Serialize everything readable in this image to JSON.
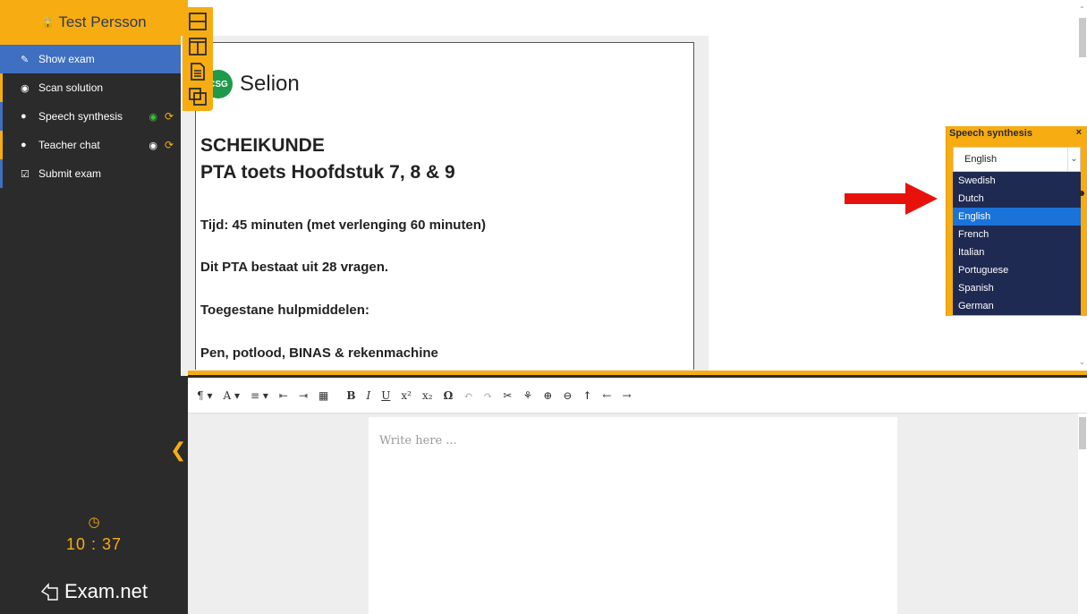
{
  "sidebar": {
    "user_name": "Test Persson",
    "items": [
      {
        "label": "Show exam",
        "icon": "pencil-square-icon",
        "active": true
      },
      {
        "label": "Scan solution",
        "icon": "camera-icon"
      },
      {
        "label": "Speech synthesis",
        "icon": "speech-bubble-icon",
        "status": "active-green"
      },
      {
        "label": "Teacher chat",
        "icon": "chat-bubbles-icon",
        "status": "target"
      },
      {
        "label": "Submit exam",
        "icon": "check-square-icon"
      }
    ],
    "timer": "10 : 37",
    "logo_text": "Exam.net"
  },
  "layout_switcher": {
    "icons": [
      "split-horizontal-icon",
      "split-vertical-icon",
      "document-icon",
      "copy-icon"
    ]
  },
  "exam": {
    "brand_badge": "CSG",
    "brand_name": "Selion",
    "subject": "SCHEIKUNDE",
    "title": "PTA toets Hoofdstuk 7, 8 & 9",
    "lines": [
      "Tijd: 45 minuten (met verlenging 60 minuten)",
      "Dit PTA bestaat uit 28 vragen.",
      "Toegestane hulpmiddelen:",
      "Pen, potlood, BINAS & rekenmachine"
    ]
  },
  "toolbar": {
    "buttons": [
      "¶ ▾",
      "A ▾",
      "≡ ▾",
      "⇤",
      "⇥",
      "▦",
      "B",
      "I",
      "U",
      "x²",
      "x₂",
      "Ω",
      "↶",
      "↷",
      "✂",
      "⚘",
      "⊕",
      "⊖",
      "↑",
      "←",
      "→"
    ]
  },
  "editor": {
    "placeholder": "Write here ..."
  },
  "speech": {
    "title": "Speech synthesis",
    "close": "×",
    "selected": "English",
    "options": [
      "Swedish",
      "Dutch",
      "English",
      "French",
      "Italian",
      "Portuguese",
      "Spanish",
      "German"
    ]
  },
  "colors": {
    "accent": "#f7ad11",
    "sidebar_bg": "#2b2b2b",
    "active_nav": "#3f6fc0",
    "dropdown_bg": "#1f2a52",
    "dropdown_selected": "#1a73d9",
    "annotation_arrow": "#e8120c"
  }
}
